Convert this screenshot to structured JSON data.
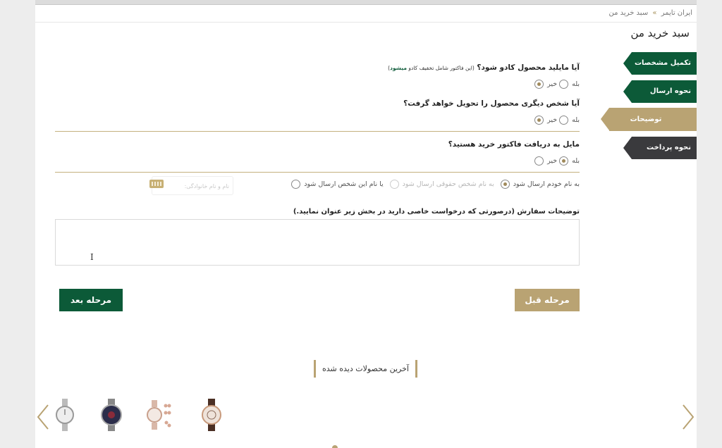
{
  "breadcrumb": {
    "home": "ایران تایمر",
    "separator": "»",
    "current": "سبد خرید من"
  },
  "page_title": "سبد خرید من",
  "steps": [
    {
      "label": "تکمیل مشخصات",
      "state": "done"
    },
    {
      "label": "نحوه ارسال",
      "state": "done"
    },
    {
      "label": "توضیحات",
      "state": "active"
    },
    {
      "label": "نحوه پرداخت",
      "state": "upcoming"
    }
  ],
  "q_gift": {
    "question": "آیا مایلید محصول کادو شود؟",
    "note_prefix": "(این فاکتور شامل تخفیف کادو ",
    "note_highlight": "میشود",
    "note_suffix": ")",
    "yes": "بله",
    "no": "خیر",
    "selected": "no"
  },
  "q_other_person": {
    "question": "آیا شخص دیگری محصول را تحویل خواهد گرفت؟",
    "yes": "بله",
    "no": "خیر",
    "selected": "no"
  },
  "q_invoice": {
    "question": "مایل به دریافت فاکتور خرید هستید؟",
    "yes": "بله",
    "no": "خیر",
    "selected": "yes"
  },
  "invoice_options": {
    "opt_self": "به نام خودم ارسال شود",
    "opt_legal": "به نام شخص حقوقی ارسال شود",
    "opt_sender": "یا نام این شخص ارسال شود",
    "selected": "self"
  },
  "name_input": {
    "placeholder": "نام و نام خانوادگی:"
  },
  "order_notes": {
    "label": "توضیحات سفارش (درصورتی که درخواست خاصی دارید در بخش زیر عنوان نمایید.)",
    "value": ""
  },
  "buttons": {
    "next": "مرحله بعد",
    "prev": "مرحله قبل"
  },
  "recent": {
    "title": "آخرین محصولات دیده شده"
  },
  "colors": {
    "brand_green": "#0c5a38",
    "brand_gold": "#b9a373",
    "dark": "#3a3a3d"
  }
}
